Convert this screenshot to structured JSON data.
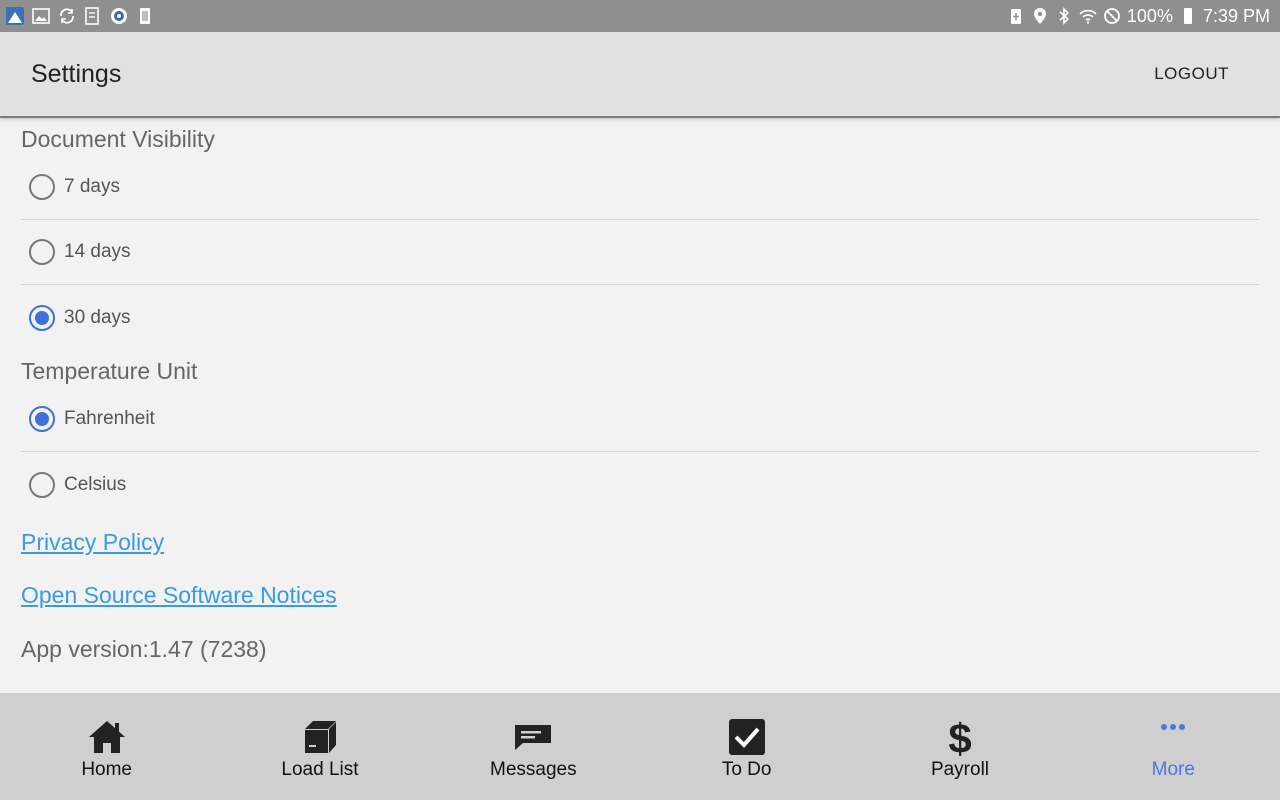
{
  "status_bar": {
    "battery_percent": "100%",
    "time": "7:39 PM"
  },
  "app_bar": {
    "title": "Settings",
    "logout_label": "LOGOUT"
  },
  "document_visibility": {
    "title": "Document Visibility",
    "options": [
      {
        "label": "7 days",
        "checked": false
      },
      {
        "label": "14 days",
        "checked": false
      },
      {
        "label": "30 days",
        "checked": true
      }
    ]
  },
  "temperature_unit": {
    "title": "Temperature Unit",
    "options": [
      {
        "label": "Fahrenheit",
        "checked": true
      },
      {
        "label": "Celsius",
        "checked": false
      }
    ]
  },
  "links": {
    "privacy_policy": "Privacy Policy",
    "open_source": "Open Source Software Notices"
  },
  "app_version": "App version:1.47 (7238)",
  "bottom_nav": {
    "items": [
      {
        "label": "Home",
        "icon": "home-icon",
        "active": false
      },
      {
        "label": "Load List",
        "icon": "box-icon",
        "active": false
      },
      {
        "label": "Messages",
        "icon": "message-icon",
        "active": false
      },
      {
        "label": "To Do",
        "icon": "checkbox-icon",
        "active": false
      },
      {
        "label": "Payroll",
        "icon": "dollar-icon",
        "active": false
      },
      {
        "label": "More",
        "icon": "more-dots-icon",
        "active": true
      }
    ]
  },
  "colors": {
    "accent": "#3f6fd8",
    "link": "#3a9be0",
    "active_nav": "#4a78e0"
  }
}
